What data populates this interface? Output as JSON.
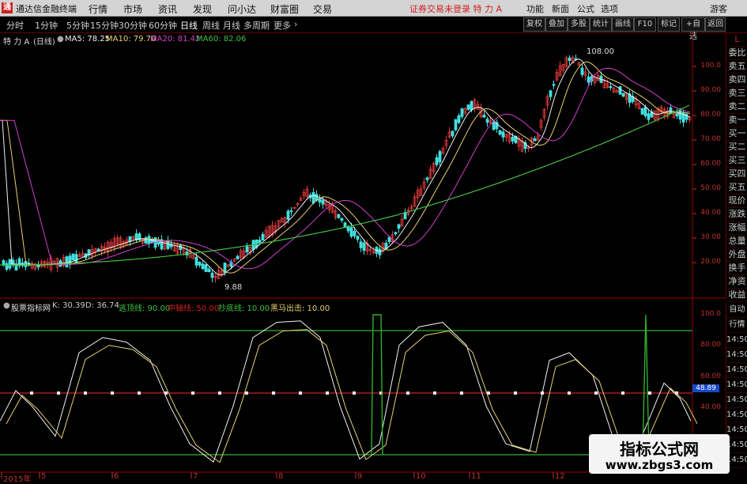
{
  "menu": {
    "app_title": "通达信金融终端",
    "items": [
      "行情",
      "市场",
      "资讯",
      "发现",
      "问小达",
      "财富圈",
      "交易"
    ],
    "warning": "证券交易未登录 特 力 A",
    "right": [
      "功能",
      "新面",
      "公式",
      "选项"
    ],
    "guest": "游客"
  },
  "toolbar": {
    "periods": [
      "分时",
      "1分钟",
      "5分钟",
      "15分钟",
      "30分钟",
      "60分钟",
      "日线",
      "周线",
      "月线",
      "多周期",
      "更多"
    ],
    "active": "日线",
    "buttons": [
      "复权",
      "叠加",
      "多股",
      "统计",
      "画线",
      "F10",
      "标记",
      "+自选",
      "返回"
    ]
  },
  "main": {
    "stock_label": "特 力 A",
    "period_label": "(日线)",
    "ma": [
      {
        "label": "MA5: 78.25",
        "color": "#f0f0f0"
      },
      {
        "label": "MA10: 79.70",
        "color": "#e8d070"
      },
      {
        "label": "MA20: 81.42",
        "color": "#d040d0"
      },
      {
        "label": "MA60: 82.06",
        "color": "#40c040"
      }
    ],
    "high_label": "108.00",
    "low_label": "9.88",
    "y_ticks": [
      "100.0",
      "90.00",
      "80.00",
      "70.00",
      "60.00",
      "50.00",
      "40.00",
      "30.00",
      "20.00"
    ]
  },
  "indicator": {
    "name": "股票指标网",
    "items": [
      {
        "label": "K: 30.39",
        "color": "#ccc"
      },
      {
        "label": "D: 36.74",
        "color": "#ccc"
      },
      {
        "label": "逃顶线: 90.00",
        "color": "#40c040"
      },
      {
        "label": "中轴线: 50.00",
        "color": "#d02020"
      },
      {
        "label": "抄底线: 10.00",
        "color": "#40c040"
      },
      {
        "label": "黑马出击: 10.00",
        "color": "#e8d070"
      }
    ],
    "y_ticks": [
      "100.0",
      "80.00",
      "60.00",
      "40.00"
    ],
    "current_value": "48.89"
  },
  "sidebar": {
    "top_labels": [
      "L",
      "委比",
      "卖五",
      "卖四",
      "卖三",
      "卖二",
      "卖一",
      "买一",
      "买二",
      "买三",
      "买四",
      "买五",
      "现价",
      "涨跌",
      "涨幅",
      "总量",
      "外盘",
      "换手",
      "净资",
      "收益"
    ],
    "bottom_labels": [
      "自动",
      "行情",
      "14:50",
      "14:50",
      "14:50",
      "14:50",
      "14:50",
      "14:50",
      "14:50",
      "14:50",
      "14:50"
    ]
  },
  "x_axis": {
    "labels": [
      "2015年",
      "5",
      "6",
      "7",
      "8",
      "9",
      "10",
      "11",
      "12"
    ]
  },
  "watermark": {
    "line1": "指标公式网",
    "line2": "www.zbgs3.com"
  },
  "colors": {
    "bull": "#e03a3a",
    "bear": "#40e0e0",
    "background": "#000000",
    "grid": "#600000"
  }
}
